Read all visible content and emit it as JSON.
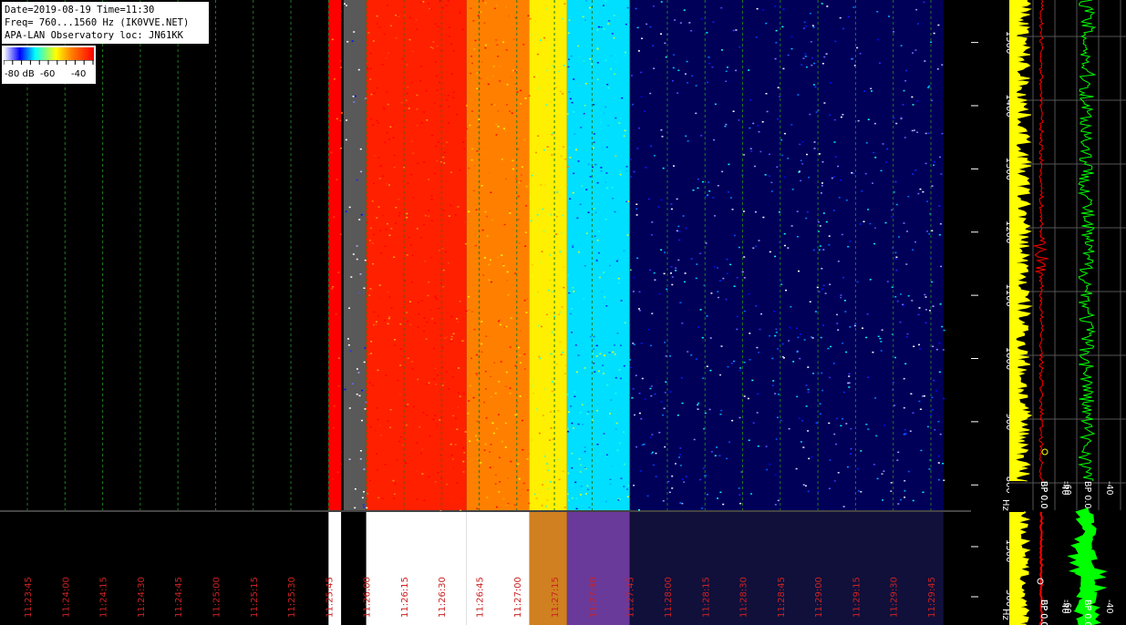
{
  "info": {
    "line1": "Date=2019-08-19 Time=11:30",
    "line2": "Freq= 760...1560 Hz (IK0VVE.NET)",
    "line3": "APA-LAN Observatory loc: JN61KK"
  },
  "legend": {
    "labels": [
      "-80 dB",
      "-60",
      "-40"
    ],
    "colors": [
      "#ffffff",
      "#0000ff",
      "#00ffff",
      "#ffff00",
      "#ff8000",
      "#ff0000"
    ]
  },
  "chart_data": [
    {
      "type": "heatmap",
      "name_hint": "waterfall",
      "x_ticks": [
        "11:23:45",
        "11:24:00",
        "11:24:15",
        "11:24:30",
        "11:24:45",
        "11:25:00",
        "11:25:15",
        "11:25:30",
        "11:25:45",
        "11:26:00",
        "11:26:15",
        "11:26:30",
        "11:26:45",
        "11:27:00",
        "11:27:15",
        "11:27:30",
        "11:27:45",
        "11:28:00",
        "11:28:15",
        "11:28:30",
        "11:28:45",
        "11:29:00",
        "11:29:15",
        "11:29:30",
        "11:29:45"
      ],
      "y_ticks": [
        800,
        900,
        1000,
        1100,
        1200,
        1300,
        1400,
        1500
      ],
      "y_unit": "Hz",
      "ylim": [
        760,
        1560
      ],
      "intensity_bands": [
        {
          "t_from": "11:25:45",
          "t_to": "11:25:50",
          "level_db": -40
        },
        {
          "t_from": "11:25:51",
          "t_to": "11:26:00",
          "level_db": -80
        },
        {
          "t_from": "11:26:00",
          "t_to": "11:26:40",
          "level_db": -42
        },
        {
          "t_from": "11:26:40",
          "t_to": "11:27:05",
          "level_db": -48
        },
        {
          "t_from": "11:27:05",
          "t_to": "11:27:20",
          "level_db": -55
        },
        {
          "t_from": "11:27:20",
          "t_to": "11:27:45",
          "level_db": -65
        },
        {
          "t_from": "11:27:45",
          "t_to": "11:29:50",
          "level_db": -72
        }
      ]
    },
    {
      "type": "heatmap",
      "name_hint": "wide-band-strip",
      "y_ticks": [
        500,
        1500
      ],
      "y_unit": "Hz"
    },
    {
      "type": "line",
      "name_hint": "spectrum-profiles",
      "x_ticks": [
        "BP 0.0",
        "-60",
        "BP 0.0",
        "-40",
        "BP 0.0",
        "-40"
      ],
      "series": [
        {
          "color": "#ffff00",
          "mean_db": -60
        },
        {
          "color": "#ff0000",
          "mean_db": -60
        },
        {
          "color": "#00ff00",
          "mean_db": -40
        }
      ]
    }
  ],
  "colors": {
    "grid": "#1f7a1f",
    "tick_label": "#cc2222",
    "axis_text": "#ffffff",
    "profile_grid": "#555555"
  }
}
